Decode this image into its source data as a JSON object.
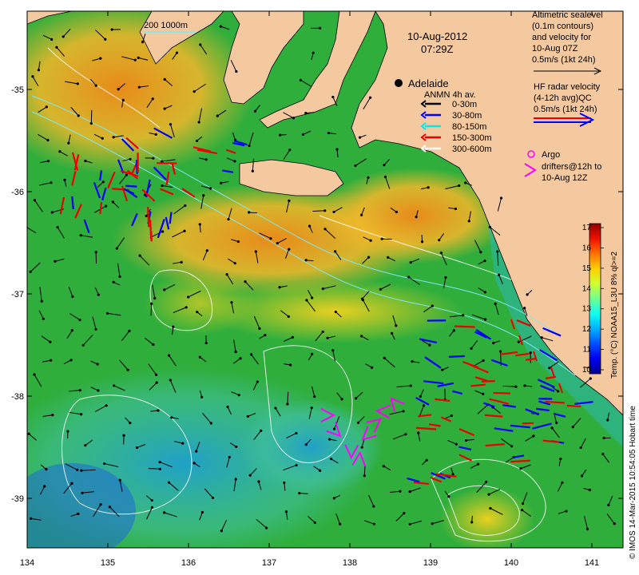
{
  "map": {
    "date": "10-Aug-2012",
    "time": "07:29Z",
    "city": "Adelaide",
    "bathymetry_label": "200  1000m",
    "x_ticks": [
      "134",
      "135",
      "136",
      "137",
      "138",
      "139",
      "140",
      "141"
    ],
    "y_ticks": [
      "-35",
      "-36",
      "-37",
      "-38",
      "-39"
    ],
    "sealevel_legend": [
      "Altimetric sealevel",
      "(0.1m contours)",
      "and velocity for",
      "10-Aug 07Z",
      "0.5m/s (1kt 24h)"
    ],
    "hf_legend": [
      "HF radar velocity",
      "(4-12h avg)QC",
      "0.5m/s (1kt 24h)"
    ],
    "anmn_title": "ANMN 4h av.",
    "anmn_items": [
      {
        "label": "0-30m",
        "color": "#000000"
      },
      {
        "label": "30-80m",
        "color": "#0000ff"
      },
      {
        "label": "80-150m",
        "color": "#00e5ee"
      },
      {
        "label": "150-300m",
        "color": "#ee0000"
      },
      {
        "label": "300-600m",
        "color": "#ffffff"
      }
    ],
    "argo_legend": [
      "Argo",
      "drifters@12h to",
      "10-Aug 12Z"
    ],
    "colorbar": {
      "ticks": [
        "10",
        "11",
        "12",
        "13",
        "14",
        "15",
        "16",
        "17"
      ],
      "label": "Temp. (°C) NOAA15_L3U 8% ql>=2",
      "colors": [
        "#00008f",
        "#0000ef",
        "#0050ff",
        "#00b0ff",
        "#10ffef",
        "#70ff8f",
        "#d0ff2f",
        "#ffcf00",
        "#ff7000",
        "#ef1000",
        "#8f0000"
      ]
    },
    "credit": "© IMOS 14-Mar-2015 10:54:05 Hobart time",
    "colors": {
      "land": "#f5c9a0",
      "ocean_green": "#2fae3c",
      "ocean_warm": "#f0b828",
      "ocean_cool": "#30b8b0",
      "argo": "#ff00ff"
    }
  }
}
